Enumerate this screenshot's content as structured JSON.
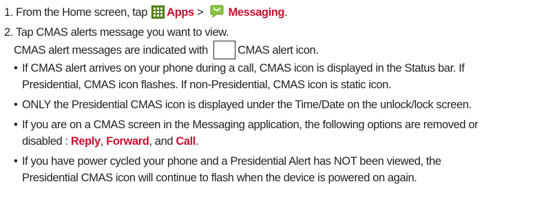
{
  "step1": {
    "prefix": "1. From the Home screen, tap ",
    "apps_label": "Apps",
    "separator": " > ",
    "messaging_label": "Messaging",
    "suffix": "."
  },
  "step2": {
    "text": "2. Tap CMAS alerts message you want to view.",
    "note_before": "CMAS alert messages are indicated with ",
    "note_after": "CMAS alert icon."
  },
  "bullets": [
    {
      "lines": [
        "If CMAS alert arrives on your phone during a call, CMAS icon is displayed in the Status bar. If",
        "Presidential, CMAS icon flashes. If non-Presidential, CMAS icon is static icon."
      ]
    },
    {
      "lines": [
        "ONLY the Presidential CMAS icon is displayed under the Time/Date on the unlock/lock screen."
      ]
    },
    {
      "line1": "If you are on a CMAS screen in the Messaging application, the following options are removed or",
      "line2_prefix": "disabled : ",
      "reply": "Reply",
      "comma1": ", ",
      "forward": "Forward",
      "and_text": ", and ",
      "call": "Call",
      "end": "."
    },
    {
      "lines": [
        "If you have power cycled your phone and a Presidential Alert has NOT been viewed, the",
        "Presidential CMAS icon will continue to flash when the device is powered on again."
      ]
    }
  ],
  "bullet_glyph": "•",
  "colors": {
    "text": "#231f20",
    "accent": "#c8102e",
    "apps_icon": "#5b8a1c",
    "messaging_icon": "#8cc63f"
  },
  "icons": {
    "apps": "apps-grid-icon",
    "messaging": "messaging-bubble-icon",
    "cmas_alert": "cmas-alert-icon"
  }
}
